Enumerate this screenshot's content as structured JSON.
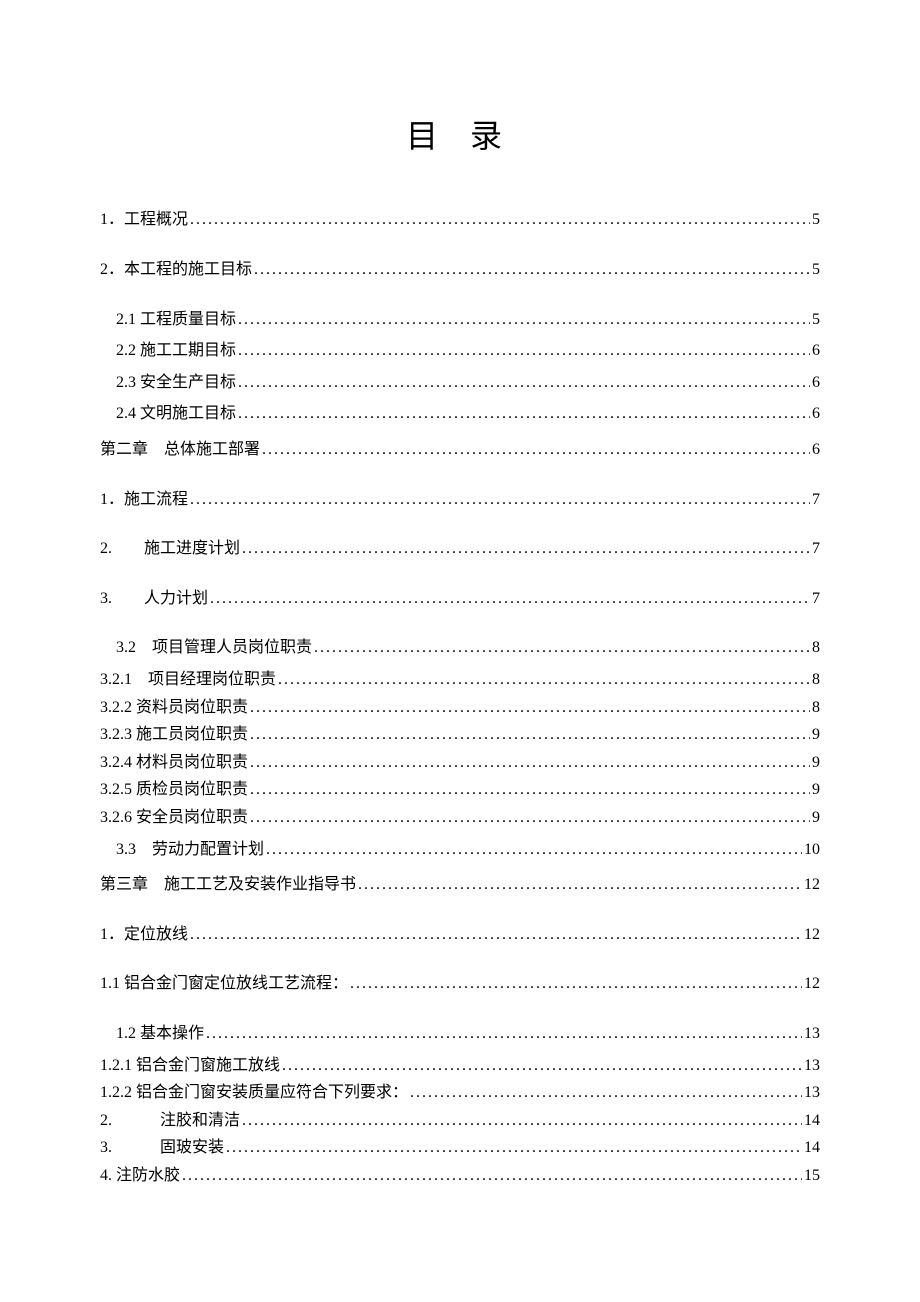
{
  "title": "目 录",
  "entries": [
    {
      "label": "1．工程概况",
      "page": "5",
      "cls": "lvl-0"
    },
    {
      "label": "2．本工程的施工目标",
      "page": "5",
      "cls": "lvl-0"
    },
    {
      "label": "2.1 工程质量目标 ",
      "page": "5",
      "cls": "lvl-1"
    },
    {
      "label": "2.2 施工工期目标 ",
      "page": "6",
      "cls": "lvl-1"
    },
    {
      "label": "2.3 安全生产目标 ",
      "page": "6",
      "cls": "lvl-1"
    },
    {
      "label": "2.4 文明施工目标 ",
      "page": "6",
      "cls": "lvl-1"
    },
    {
      "label": "第二章　总体施工部署",
      "page": "6",
      "cls": "chapter"
    },
    {
      "label": "1．施工流程",
      "page": "7",
      "cls": "lvl-0"
    },
    {
      "label": "2.　　施工进度计划",
      "page": "7",
      "cls": "lvl-0"
    },
    {
      "label": "3.　　人力计划",
      "page": "7",
      "cls": "lvl-0"
    },
    {
      "label": "3.2　项目管理人员岗位职责",
      "page": "8",
      "cls": "lvl-1"
    },
    {
      "label": "3.2.1　项目经理岗位职责 ",
      "page": "8",
      "cls": "lvl-2 tight"
    },
    {
      "label": "3.2.2 资料员岗位职责 ",
      "page": "8",
      "cls": "lvl-2 tight"
    },
    {
      "label": "3.2.3 施工员岗位职责 ",
      "page": "9",
      "cls": "lvl-2 tight"
    },
    {
      "label": "3.2.4 材料员岗位职责 ",
      "page": "9",
      "cls": "lvl-2 tight"
    },
    {
      "label": "3.2.5 质检员岗位职责 ",
      "page": "9",
      "cls": "lvl-2 tight"
    },
    {
      "label": "3.2.6 安全员岗位职责 ",
      "page": "9",
      "cls": "lvl-2 tight"
    },
    {
      "label": "3.3　劳动力配置计划",
      "page": "10",
      "cls": "lvl-1"
    },
    {
      "label": "第三章　施工工艺及安装作业指导书",
      "page": "12",
      "cls": "chapter"
    },
    {
      "label": "1．定位放线",
      "page": "12",
      "cls": "lvl-0"
    },
    {
      "label": "1.1 铝合金门窗定位放线工艺流程：",
      "page": "12",
      "cls": "lvl-0"
    },
    {
      "label": "1.2 基本操作",
      "page": "13",
      "cls": "lvl-1"
    },
    {
      "label": "1.2.1 铝合金门窗施工放线",
      "page": "13",
      "cls": "lvl-2 tight"
    },
    {
      "label": "1.2.2 铝合金门窗安装质量应符合下列要求：",
      "page": "13",
      "cls": "lvl-2 tight"
    },
    {
      "label": "2.　　　注胶和清洁 ",
      "page": "14",
      "cls": "lvl-2 tight"
    },
    {
      "label": "3.　　　固玻安装 ",
      "page": "14",
      "cls": "lvl-2 tight"
    },
    {
      "label": "4. 注防水胶 ",
      "page": "15",
      "cls": "lvl-2 tight"
    }
  ]
}
